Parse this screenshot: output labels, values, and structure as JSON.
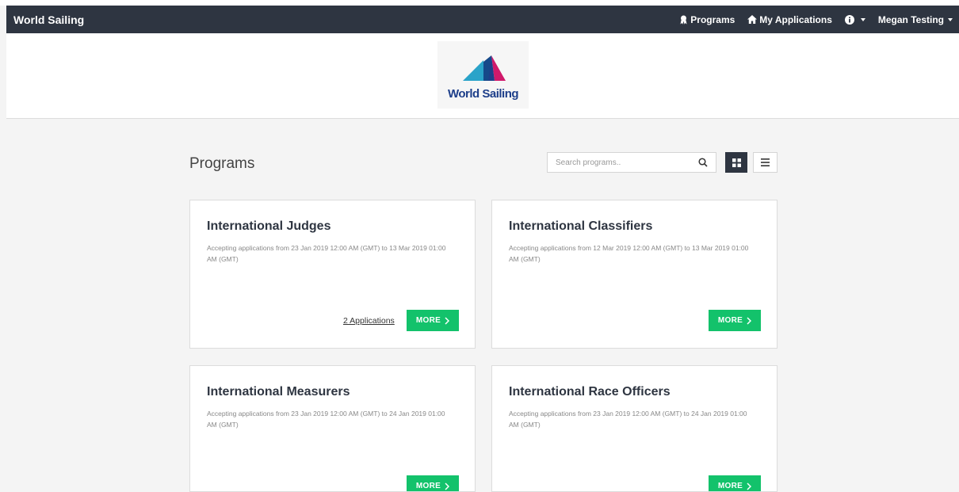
{
  "navbar": {
    "brand": "World Sailing",
    "programs_label": "Programs",
    "my_applications_label": "My Applications",
    "user_name": "Megan Testing"
  },
  "header": {
    "logo_text": "World Sailing"
  },
  "programs_page": {
    "title": "Programs",
    "search_placeholder": "Search programs.."
  },
  "cards": [
    {
      "title": "International Judges",
      "description": "Accepting applications from 23 Jan 2019 12:00 AM (GMT) to 13 Mar 2019 01:00 AM (GMT)",
      "applications_link": "2 Applications",
      "more_label": "MORE"
    },
    {
      "title": "International Classifiers",
      "description": "Accepting applications from 12 Mar 2019 12:00 AM (GMT) to 13 Mar 2019 01:00 AM (GMT)",
      "more_label": "MORE"
    },
    {
      "title": "International Measurers",
      "description": "Accepting applications from 23 Jan 2019 12:00 AM (GMT) to 24 Jan 2019 01:00 AM (GMT)",
      "more_label": "MORE"
    },
    {
      "title": "International Race Officers",
      "description": "Accepting applications from 23 Jan 2019 12:00 AM (GMT) to 24 Jan 2019 01:00 AM (GMT)",
      "more_label": "MORE"
    }
  ],
  "colors": {
    "navbar_bg": "#2e3541",
    "accent_green": "#13c26b",
    "logo_blue": "#1e3f8a",
    "logo_teal": "#2aa3c9",
    "logo_magenta": "#d0196b"
  }
}
